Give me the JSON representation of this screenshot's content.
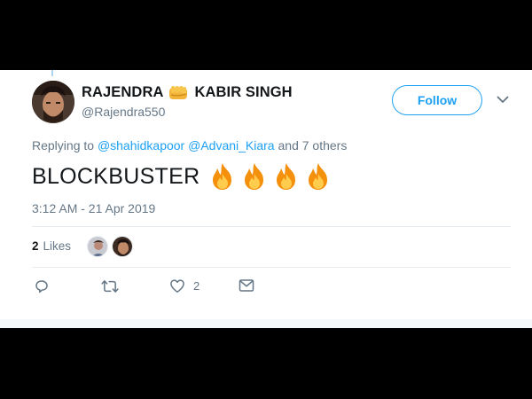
{
  "tweet": {
    "author": {
      "name_first": "RAJENDRA",
      "name_second": "KABIR SINGH",
      "name_emoji": "fist-emoji",
      "handle": "@Rajendra550"
    },
    "follow_label": "Follow",
    "replying_to": {
      "prefix": "Replying to",
      "mention_1": "@shahidkapoor",
      "mention_2": "@Advani_Kiara",
      "suffix": "and 7 others"
    },
    "text": "BLOCKBUSTER",
    "emojis": [
      "fire-emoji",
      "fire-emoji",
      "fire-emoji",
      "fire-emoji"
    ],
    "timestamp": "3:12 AM - 21 Apr 2019",
    "likes": {
      "count": "2",
      "label": "Likes"
    },
    "actions": {
      "reply_icon": "reply-icon",
      "retweet_icon": "retweet-icon",
      "like_icon": "heart-icon",
      "like_count": "2",
      "dm_icon": "envelope-icon"
    }
  },
  "colors": {
    "accent": "#1da1f2",
    "text_primary": "#14171a",
    "text_secondary": "#657786",
    "divider": "#e6ecf0",
    "frame": "#000000"
  }
}
